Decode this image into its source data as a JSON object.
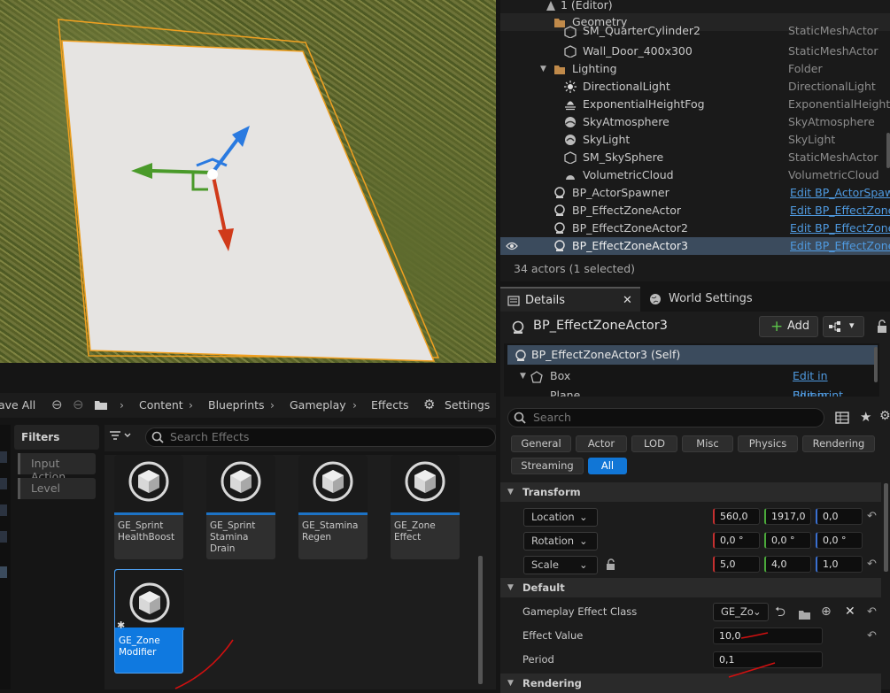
{
  "outliner": {
    "editor_row": "1 (Editor)",
    "rows": [
      {
        "name": "Geometry",
        "type": "",
        "link": "",
        "kind": "folder"
      },
      {
        "name": "SM_QuarterCylinder2",
        "type": "StaticMeshActor",
        "link": "",
        "kind": "mesh"
      },
      {
        "name": "Wall_Door_400x300",
        "type": "StaticMeshActor",
        "link": "",
        "kind": "mesh"
      },
      {
        "name": "Lighting",
        "type": "Folder",
        "link": "",
        "kind": "folder"
      },
      {
        "name": "DirectionalLight",
        "type": "DirectionalLight",
        "link": "",
        "kind": "light"
      },
      {
        "name": "ExponentialHeightFog",
        "type": "ExponentialHeightF",
        "link": "",
        "kind": "fog"
      },
      {
        "name": "SkyAtmosphere",
        "type": "SkyAtmosphere",
        "link": "",
        "kind": "sky"
      },
      {
        "name": "SkyLight",
        "type": "SkyLight",
        "link": "",
        "kind": "sky"
      },
      {
        "name": "SM_SkySphere",
        "type": "StaticMeshActor",
        "link": "",
        "kind": "mesh"
      },
      {
        "name": "VolumetricCloud",
        "type": "VolumetricCloud",
        "link": "",
        "kind": "cloud"
      },
      {
        "name": "BP_ActorSpawner",
        "type": "",
        "link": "Edit BP_ActorSpaw",
        "kind": "bp"
      },
      {
        "name": "BP_EffectZoneActor",
        "type": "",
        "link": "Edit BP_EffectZone",
        "kind": "bp"
      },
      {
        "name": "BP_EffectZoneActor2",
        "type": "",
        "link": "Edit BP_EffectZone",
        "kind": "bp"
      },
      {
        "name": "BP_EffectZoneActor3",
        "type": "",
        "link": "Edit BP_EffectZone",
        "kind": "bp"
      }
    ],
    "footer": "34 actors (1 selected)"
  },
  "details": {
    "tab_details": "Details",
    "tab_world": "World Settings",
    "actor_name": "BP_EffectZoneActor3",
    "add_label": "Add",
    "self_row": "BP_EffectZoneActor3 (Self)",
    "box_label": "Box",
    "edit_blueprint": "Edit in Blueprint",
    "plane_label": "Plane",
    "search_placeholder": "Search",
    "categories": [
      "General",
      "Actor",
      "LOD",
      "Misc",
      "Physics",
      "Rendering",
      "Streaming",
      "All"
    ],
    "transform_header": "Transform",
    "location_label": "Location",
    "rotation_label": "Rotation",
    "scale_label": "Scale",
    "location": [
      "560,0",
      "1917,0",
      "0,0"
    ],
    "rotation": [
      "0,0 °",
      "0,0 °",
      "0,0 °"
    ],
    "scale": [
      "5,0",
      "4,0",
      "1,0"
    ],
    "default_header": "Default",
    "ge_class_label": "Gameplay Effect Class",
    "ge_class_value": "GE_Zo",
    "effect_value_label": "Effect Value",
    "effect_value": "10,0",
    "period_label": "Period",
    "period_value": "0,1",
    "rendering_header": "Rendering"
  },
  "content_browser": {
    "save_all": "ave All",
    "path": [
      "Content",
      "Blueprints",
      "Gameplay",
      "Effects"
    ],
    "settings": "Settings",
    "filters_label": "Filters",
    "filter_items": [
      "Input Action",
      "Level"
    ],
    "search_placeholder": "Search Effects",
    "assets": [
      {
        "name": "GE_Sprint HealthBoost",
        "selected": false
      },
      {
        "name": "GE_Sprint Stamina Drain",
        "selected": false
      },
      {
        "name": "GE_Stamina Regen",
        "selected": false
      },
      {
        "name": "GE_Zone Effect",
        "selected": false
      },
      {
        "name": "GE_Zone Modifier",
        "selected": true
      }
    ]
  },
  "colors": {
    "accent": "#1176d6",
    "selection_row": "#3b4b5d",
    "gizmo_x": "#d03a1a",
    "gizmo_y": "#4a9a2a",
    "gizmo_z": "#2a7ae0",
    "annotation": "#d01010"
  }
}
